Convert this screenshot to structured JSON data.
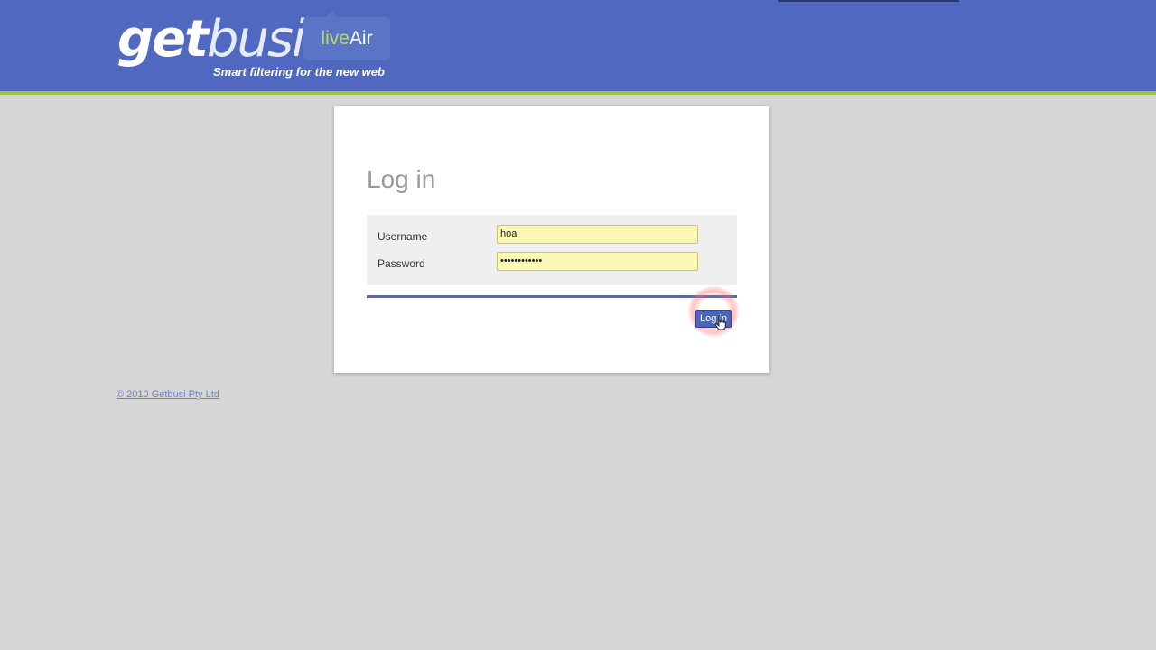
{
  "header": {
    "logo_part1": "get",
    "logo_part2": "busi",
    "badge_live": "live",
    "badge_air": "Air",
    "tagline": "Smart filtering for the new web"
  },
  "login": {
    "title": "Log in",
    "username_label": "Username",
    "username_value": "hoa",
    "password_label": "Password",
    "password_value": "••••••••••••",
    "button_label": "Log in"
  },
  "footer": {
    "copyright": "© 2010 Getbusi Pty Ltd"
  },
  "colors": {
    "header": "#5068bf",
    "accent_stripe": "#9bc43e",
    "input_fill": "#fbf7b4",
    "button": "#4b66b9"
  }
}
